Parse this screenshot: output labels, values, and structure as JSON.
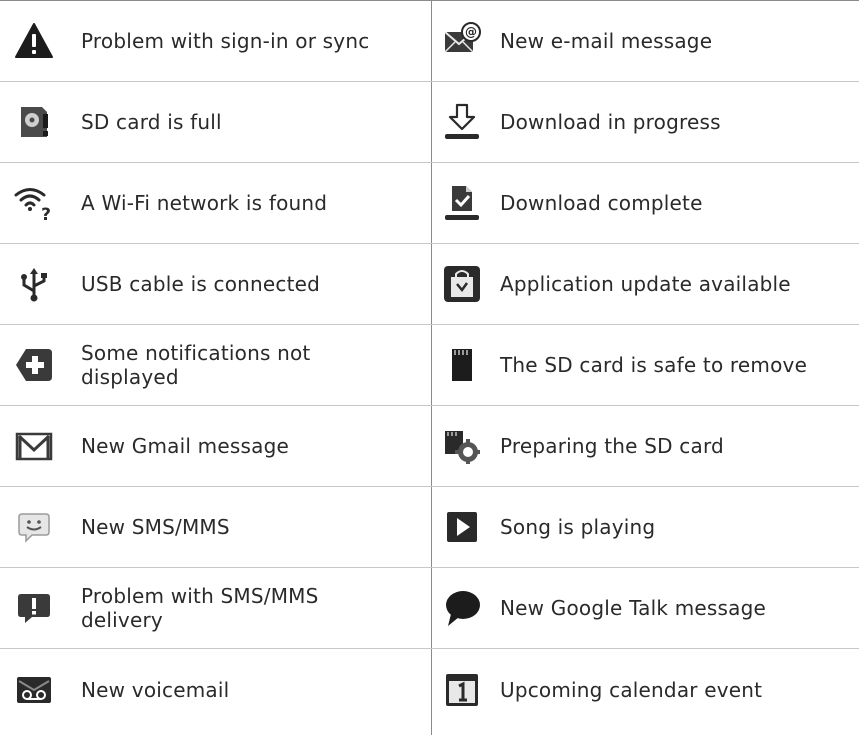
{
  "rows": [
    {
      "left": {
        "icon": "warning-triangle-icon",
        "label": "Problem with sign-in or sync"
      },
      "right": {
        "icon": "email-at-icon",
        "label": "New e-mail message"
      }
    },
    {
      "left": {
        "icon": "sd-card-full-icon",
        "label": "SD card is full"
      },
      "right": {
        "icon": "download-arrow-icon",
        "label": "Download in progress"
      }
    },
    {
      "left": {
        "icon": "wifi-question-icon",
        "label": "A Wi-Fi network is found"
      },
      "right": {
        "icon": "download-complete-icon",
        "label": "Download complete"
      }
    },
    {
      "left": {
        "icon": "usb-icon",
        "label": "USB cable is connected"
      },
      "right": {
        "icon": "app-update-bag-icon",
        "label": "Application update available"
      }
    },
    {
      "left": {
        "icon": "plus-notification-icon",
        "label": "Some notifications not\ndisplayed"
      },
      "right": {
        "icon": "sd-card-icon",
        "label": "The SD card is safe to remove"
      }
    },
    {
      "left": {
        "icon": "gmail-icon",
        "label": "New Gmail message"
      },
      "right": {
        "icon": "sd-card-gear-icon",
        "label": "Preparing the SD card"
      }
    },
    {
      "left": {
        "icon": "sms-smiley-icon",
        "label": "New SMS/MMS"
      },
      "right": {
        "icon": "play-icon",
        "label": "Song is playing"
      }
    },
    {
      "left": {
        "icon": "sms-error-icon",
        "label": "Problem with SMS/MMS\ndelivery"
      },
      "right": {
        "icon": "talk-bubble-icon",
        "label": "New Google Talk message"
      }
    },
    {
      "left": {
        "icon": "voicemail-icon",
        "label": "New voicemail"
      },
      "right": {
        "icon": "calendar-icon",
        "label": "Upcoming calendar event"
      }
    }
  ]
}
